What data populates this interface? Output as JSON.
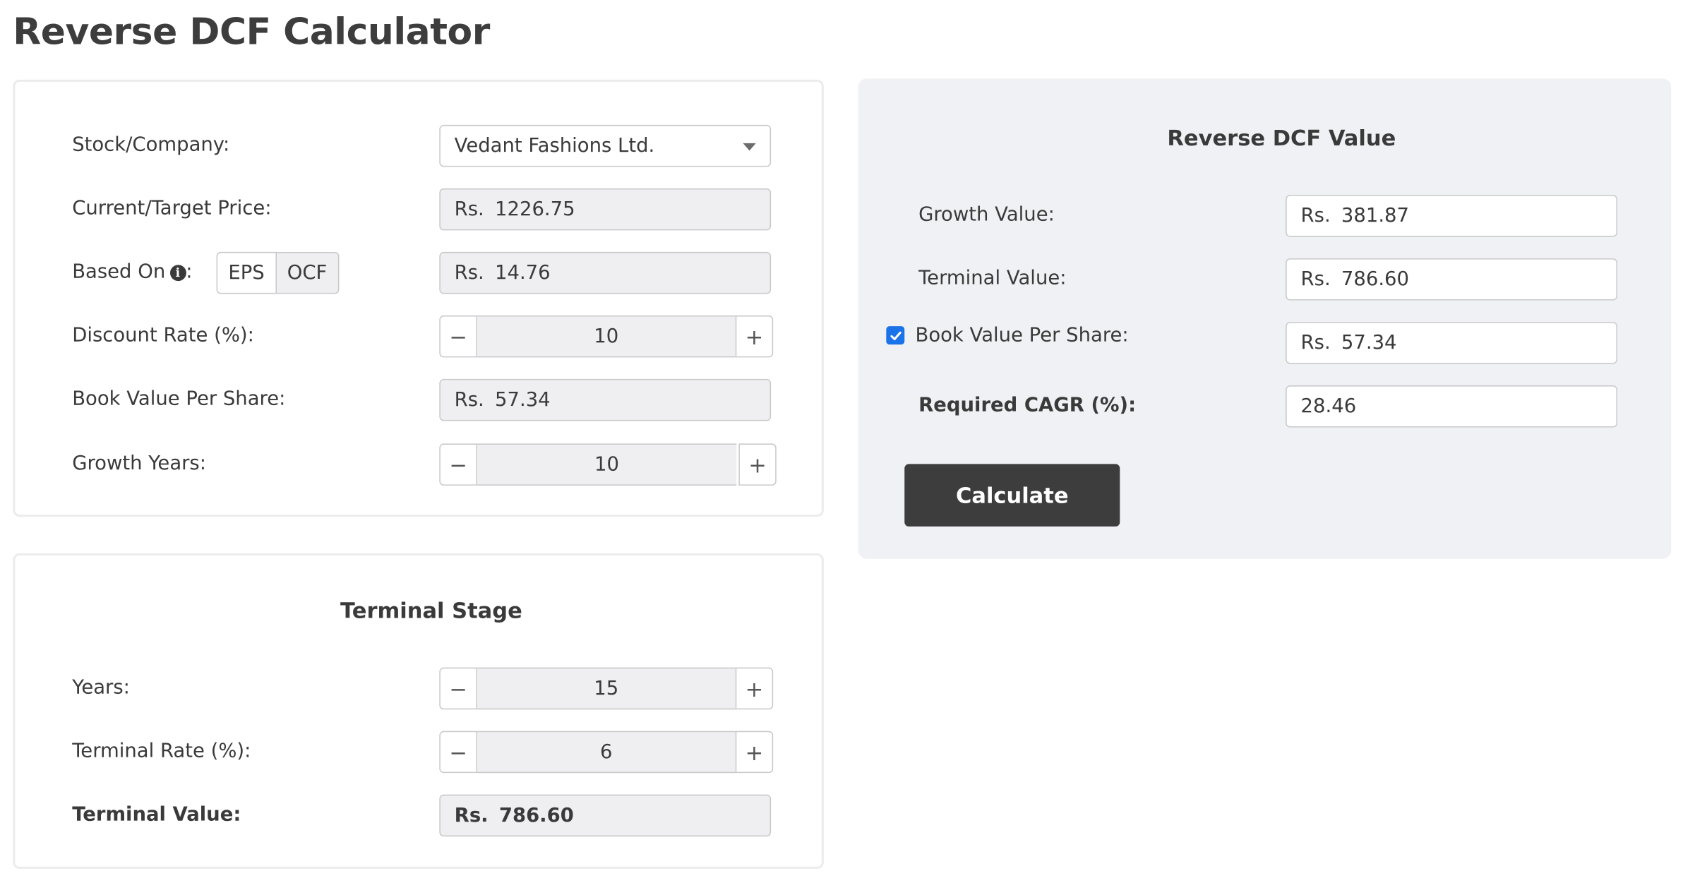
{
  "page": {
    "title": "Reverse DCF Calculator"
  },
  "inputs": {
    "stock_label": "Stock/Company:",
    "stock_value": "Vedant Fashions Ltd.",
    "price_label": "Current/Target Price:",
    "price_currency": "Rs.",
    "price_value": "1226.75",
    "based_on_label": "Based On",
    "based_on_colon": ":",
    "based_on_options": [
      "EPS",
      "OCF"
    ],
    "based_on_selected": "OCF",
    "based_on_currency": "Rs.",
    "based_on_value": "14.76",
    "discount_label": "Discount Rate (%):",
    "discount_value": "10",
    "bvps_label": "Book Value Per Share:",
    "bvps_currency": "Rs.",
    "bvps_value": "57.34",
    "growth_years_label": "Growth Years:",
    "growth_years_value": "10"
  },
  "terminal": {
    "title": "Terminal Stage",
    "years_label": "Years:",
    "years_value": "15",
    "rate_label": "Terminal Rate (%):",
    "rate_value": "6",
    "tv_label": "Terminal Value:",
    "tv_currency": "Rs.",
    "tv_value": "786.60"
  },
  "result": {
    "title": "Reverse DCF Value",
    "growth_label": "Growth Value:",
    "growth_currency": "Rs.",
    "growth_value": "381.87",
    "terminal_label": "Terminal Value:",
    "terminal_currency": "Rs.",
    "terminal_value": "786.60",
    "bvps_checked": true,
    "bvps_label": "Book Value Per Share:",
    "bvps_currency": "Rs.",
    "bvps_value": "57.34",
    "cagr_label": "Required CAGR (%):",
    "cagr_value": "28.46",
    "calculate_label": "Calculate"
  },
  "controls": {
    "minus_symbol": "−",
    "plus_symbol": "+",
    "info_symbol": "i"
  },
  "colors": {
    "accent_dark": "#3d3d3d",
    "checkbox": "#1a73e8",
    "field_bg": "#efeff2",
    "result_bg": "#f0f1f4"
  }
}
